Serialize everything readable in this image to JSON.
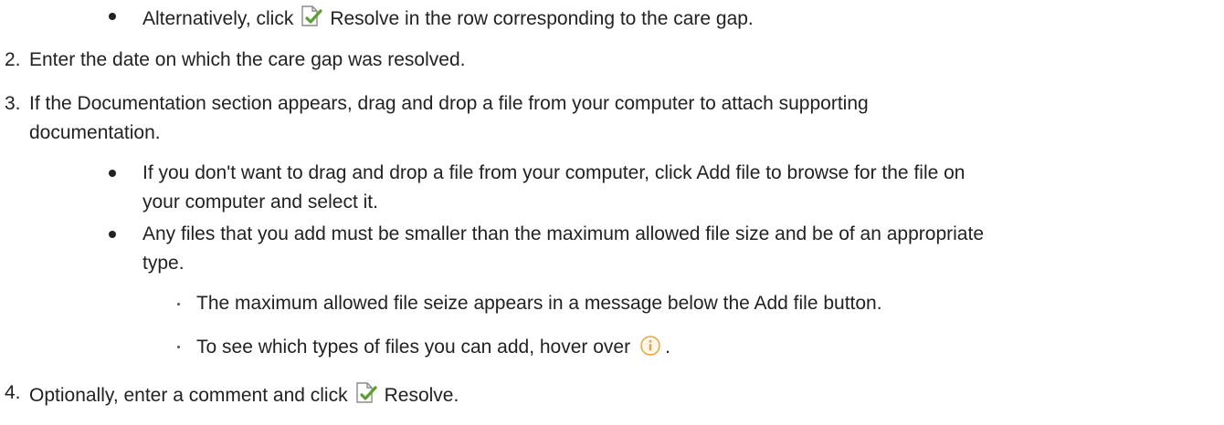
{
  "bullet_alt": {
    "before": "Alternatively, click",
    "icon": "resolve-icon",
    "after": "Resolve in the row corresponding to the care gap."
  },
  "steps": [
    {
      "number": "2.",
      "text": "Enter the date on which the care gap was resolved."
    },
    {
      "number": "3.",
      "line1": "If the Documentation section appears, drag and drop a file from your computer to attach supporting",
      "line2": "documentation."
    },
    {
      "number": "4.",
      "before": "Optionally, enter a comment and click",
      "icon": "resolve-icon",
      "after": "Resolve."
    }
  ],
  "step3_bullets": [
    {
      "line1": "If you don't want to drag and drop a file from your computer, click Add file to browse for the file on",
      "line2": "your computer and select it."
    },
    {
      "line1": "Any files that you add must be smaller than the maximum allowed file size and be of an appropriate",
      "line2": "type."
    }
  ],
  "sub_bullets": [
    {
      "text": "The maximum allowed file seize appears in a message below the Add file button."
    },
    {
      "before": "To see which types of files you can add, hover over",
      "icon": "info-icon",
      "after": "."
    }
  ],
  "colors": {
    "text": "#222222",
    "resolve_icon_check": "#5aa02c",
    "info_icon": "#f0a030"
  }
}
